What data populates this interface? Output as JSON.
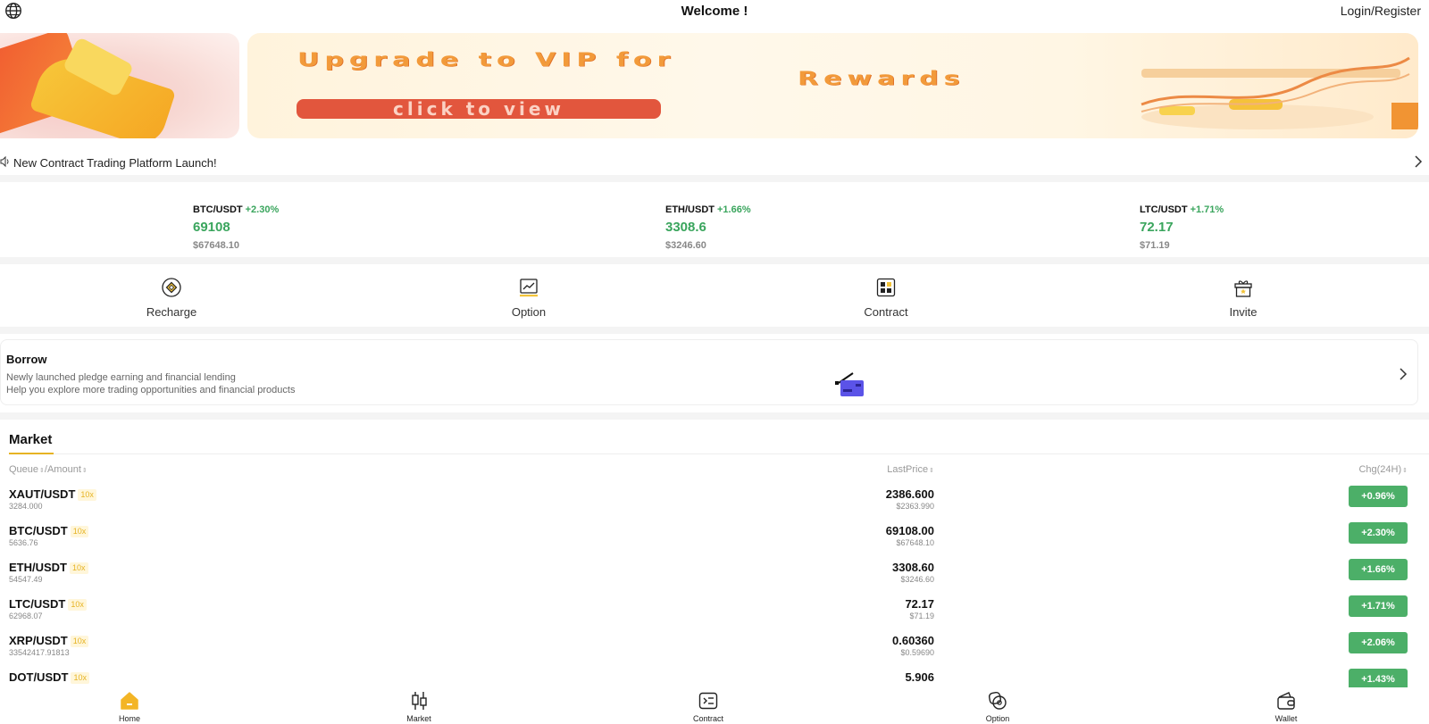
{
  "header": {
    "title": "Welcome !",
    "login_label": "Login/Register"
  },
  "banner": {
    "headline_line1": "Upgrade to VIP for",
    "headline_line2": "Rewards",
    "cta_label": "click to view"
  },
  "notice": {
    "text": "New Contract Trading Platform Launch!"
  },
  "tickers": [
    {
      "pair": "BTC/USDT",
      "change": "+2.30%",
      "price": "69108",
      "usd": "$67648.10"
    },
    {
      "pair": "ETH/USDT",
      "change": "+1.66%",
      "price": "3308.6",
      "usd": "$3246.60"
    },
    {
      "pair": "LTC/USDT",
      "change": "+1.71%",
      "price": "72.17",
      "usd": "$71.19"
    }
  ],
  "quick_actions": [
    {
      "label": "Recharge",
      "icon": "recharge-icon"
    },
    {
      "label": "Option",
      "icon": "option-chart-icon"
    },
    {
      "label": "Contract",
      "icon": "contract-grid-icon"
    },
    {
      "label": "Invite",
      "icon": "gift-icon"
    }
  ],
  "borrow": {
    "title": "Borrow",
    "line1": "Newly launched pledge earning and financial lending",
    "line2": "Help you explore more trading opportunities and financial products"
  },
  "market": {
    "title": "Market",
    "columns": {
      "queue": "Queue",
      "amount": "/Amount",
      "last_price": "LastPrice",
      "change": "Chg(24H)"
    },
    "rows": [
      {
        "symbol": "XAUT/USDT",
        "leverage": "10x",
        "amount": "3284.000",
        "last": "2386.600",
        "usd": "$2363.990",
        "change": "+0.96%"
      },
      {
        "symbol": "BTC/USDT",
        "leverage": "10x",
        "amount": "5636.76",
        "last": "69108.00",
        "usd": "$67648.10",
        "change": "+2.30%"
      },
      {
        "symbol": "ETH/USDT",
        "leverage": "10x",
        "amount": "54547.49",
        "last": "3308.60",
        "usd": "$3246.60",
        "change": "+1.66%"
      },
      {
        "symbol": "LTC/USDT",
        "leverage": "10x",
        "amount": "62968.07",
        "last": "72.17",
        "usd": "$71.19",
        "change": "+1.71%"
      },
      {
        "symbol": "XRP/USDT",
        "leverage": "10x",
        "amount": "33542417.91813",
        "last": "0.60360",
        "usd": "$0.59690",
        "change": "+2.06%"
      },
      {
        "symbol": "DOT/USDT",
        "leverage": "10x",
        "amount": "",
        "last": "5.906",
        "usd": "",
        "change": "+1.43%"
      }
    ]
  },
  "bottom_nav": [
    {
      "label": "Home",
      "active": true
    },
    {
      "label": "Market",
      "active": false
    },
    {
      "label": "Contract",
      "active": false
    },
    {
      "label": "Option",
      "active": false
    },
    {
      "label": "Wallet",
      "active": false
    }
  ],
  "colors": {
    "accent": "#e6b323",
    "up": "#3aa55d",
    "up_badge": "#4caf68"
  }
}
